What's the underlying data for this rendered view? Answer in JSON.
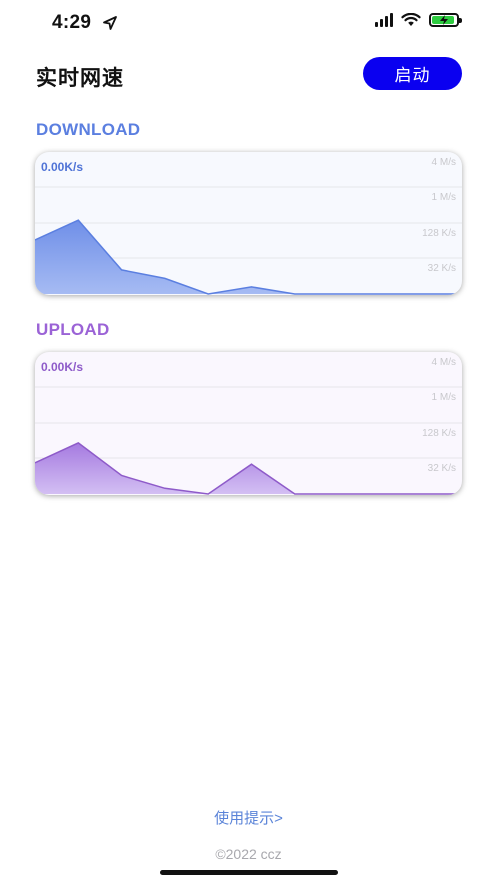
{
  "status_bar": {
    "time": "4:29",
    "icons": [
      "location-arrow-icon",
      "signal-icon",
      "wifi-icon",
      "battery-charging-icon"
    ]
  },
  "header": {
    "title": "实时网速",
    "start_button": "启动"
  },
  "colors": {
    "accent": "#0a00f0",
    "download": "#5b7fe0",
    "upload": "#9b63d6"
  },
  "download": {
    "section_label": "DOWNLOAD",
    "current_speed": "0.00K/s",
    "ticks": [
      "4 M/s",
      "1 M/s",
      "128 K/s",
      "32 K/s"
    ]
  },
  "upload": {
    "section_label": "UPLOAD",
    "current_speed": "0.00K/s",
    "ticks": [
      "4 M/s",
      "1 M/s",
      "128 K/s",
      "32 K/s"
    ]
  },
  "chart_data": [
    {
      "type": "area",
      "series": [
        {
          "values": [
            0.38,
            0.52,
            0.17,
            0.11,
            0.0,
            0.05,
            0.0,
            0.0,
            0.0,
            0.0
          ]
        }
      ],
      "y_scale": "log",
      "grid": true
    },
    {
      "type": "area",
      "series": [
        {
          "values": [
            0.22,
            0.36,
            0.13,
            0.04,
            0.0,
            0.21,
            0.0,
            0.0,
            0.0,
            0.0
          ]
        }
      ],
      "y_scale": "log",
      "grid": true
    }
  ],
  "footer": {
    "usage_tips": "使用提示>",
    "copyright": "©2022 ccz"
  }
}
